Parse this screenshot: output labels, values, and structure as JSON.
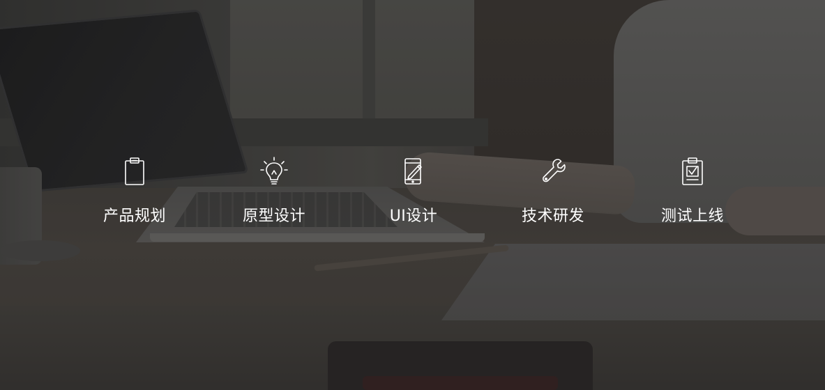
{
  "steps": [
    {
      "label": "产品规划",
      "icon": "clipboard-icon"
    },
    {
      "label": "原型设计",
      "icon": "lightbulb-icon"
    },
    {
      "label": "UI设计",
      "icon": "phone-pen-icon"
    },
    {
      "label": "技术研发",
      "icon": "wrench-icon"
    },
    {
      "label": "测试上线",
      "icon": "checklist-icon"
    }
  ],
  "colors": {
    "text": "#ffffff",
    "overlay": "#1e1e1e"
  }
}
